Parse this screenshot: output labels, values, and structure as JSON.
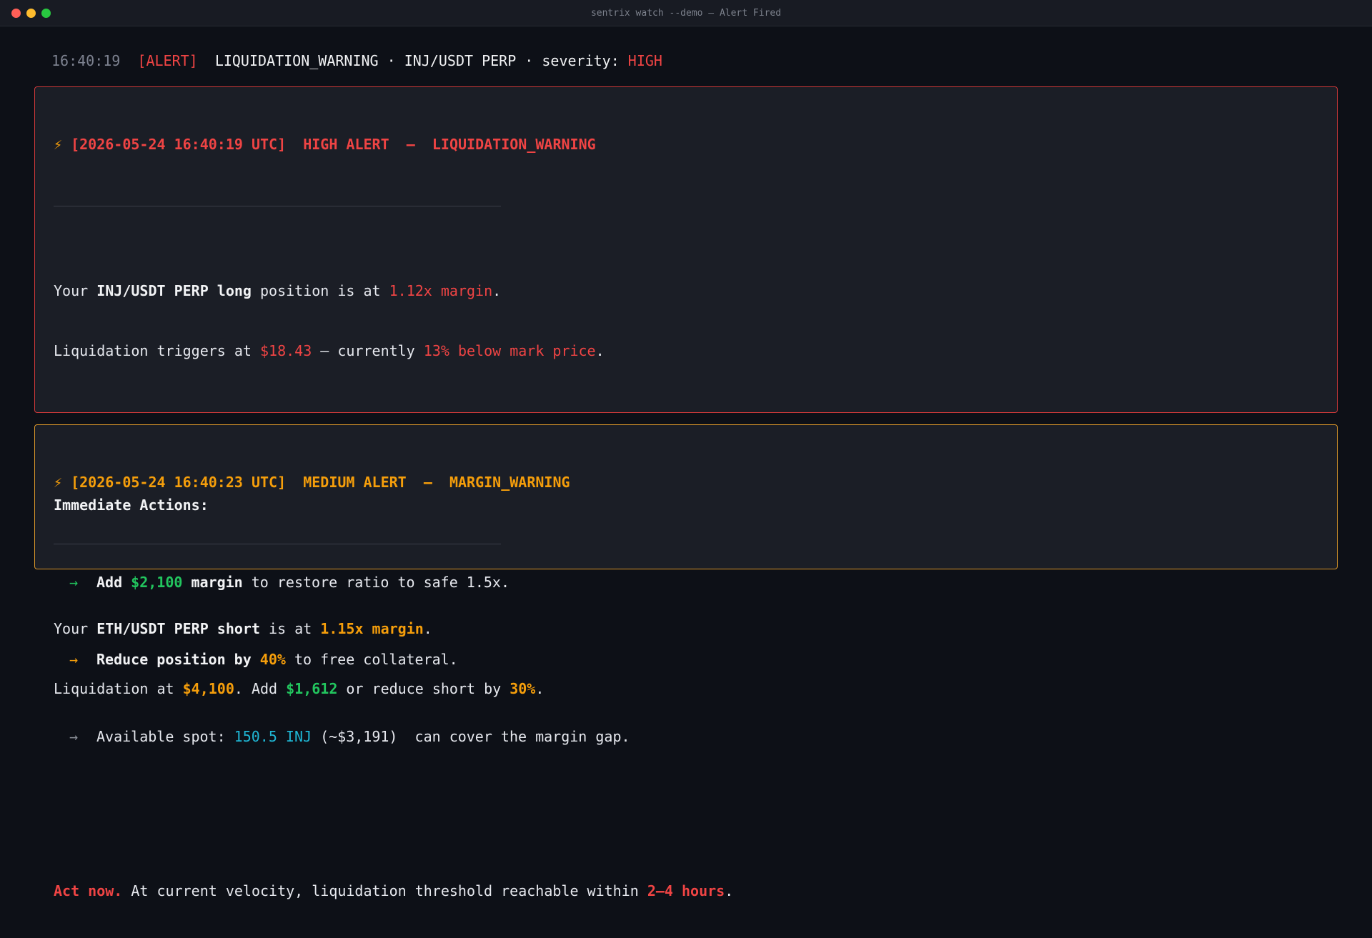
{
  "window": {
    "title": "sentrix watch --demo — Alert Fired"
  },
  "log_line": {
    "time": "16:40:19",
    "tag": "[ALERT]",
    "text": "LIQUIDATION_WARNING · INJ/USDT PERP · severity: ",
    "severity": "HIGH"
  },
  "alerts": [
    {
      "icon": "lightning-icon",
      "timestamp": "[2026-05-24 16:40:19 UTC]",
      "level": "HIGH ALERT",
      "dash": "—",
      "type": "LIQUIDATION_WARNING",
      "color": "#ef4444",
      "line1": {
        "a": "Your ",
        "position": "INJ/USDT PERP long",
        "b": " position is at ",
        "margin": "1.12x margin",
        "c": "."
      },
      "line2": {
        "a": "Liquidation triggers at ",
        "price": "$18.43",
        "b": " — currently ",
        "pct": "13% below mark price",
        "c": "."
      },
      "actions_heading": "Immediate Actions:",
      "actions": [
        {
          "arrow": "→",
          "arrow_color": "#22c55e",
          "a": "Add ",
          "value": "$2,100",
          "b": " margin",
          "c": " to restore ratio to safe 1.5x."
        },
        {
          "arrow": "→",
          "arrow_color": "#f59e0b",
          "a": "Reduce position by ",
          "value": "40%",
          "c": " to free collateral."
        },
        {
          "arrow": "→",
          "arrow_color": "#8a8f98",
          "a": "Available spot: ",
          "value": "150.5 INJ",
          "c": " (~$3,191)  can cover the margin gap."
        }
      ],
      "footer": {
        "act": "Act now.",
        "text": " At current velocity, liquidation threshold reachable within ",
        "window": "2–4 hours",
        "end": "."
      }
    },
    {
      "icon": "lightning-icon",
      "timestamp": "[2026-05-24 16:40:23 UTC]",
      "level": "MEDIUM ALERT",
      "dash": "—",
      "type": "MARGIN_WARNING",
      "color": "#f59e0b",
      "line1": {
        "a": "Your ",
        "position": "ETH/USDT PERP short",
        "b": " is at ",
        "margin": "1.15x margin",
        "c": "."
      },
      "line2": {
        "a": "Liquidation at ",
        "price": "$4,100",
        "b": ". Add ",
        "add": "$1,612",
        "c": " or reduce short by ",
        "pct": "30%",
        "d": "."
      }
    }
  ]
}
